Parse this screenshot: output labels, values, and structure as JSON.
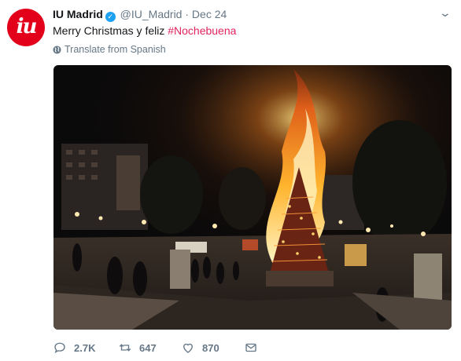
{
  "tweet": {
    "display_name": "IU Madrid",
    "handle": "@IU_Madrid",
    "separator": "·",
    "date": "Dec 24",
    "avatar_text": "iu",
    "text_prefix": "Merry Christmas y feliz ",
    "hashtag": "#Nochebuena",
    "translate_label": "Translate from Spanish"
  },
  "actions": {
    "replies": "2.7K",
    "retweets": "647",
    "likes": "870"
  },
  "colors": {
    "brand_red": "#e2001a",
    "hashtag": "#e0245e",
    "verified_blue": "#1da1f2",
    "muted": "#657786"
  },
  "icons": [
    "verified-icon",
    "chevron-down-icon",
    "globe-icon",
    "reply-icon",
    "retweet-icon",
    "like-icon",
    "message-icon"
  ]
}
